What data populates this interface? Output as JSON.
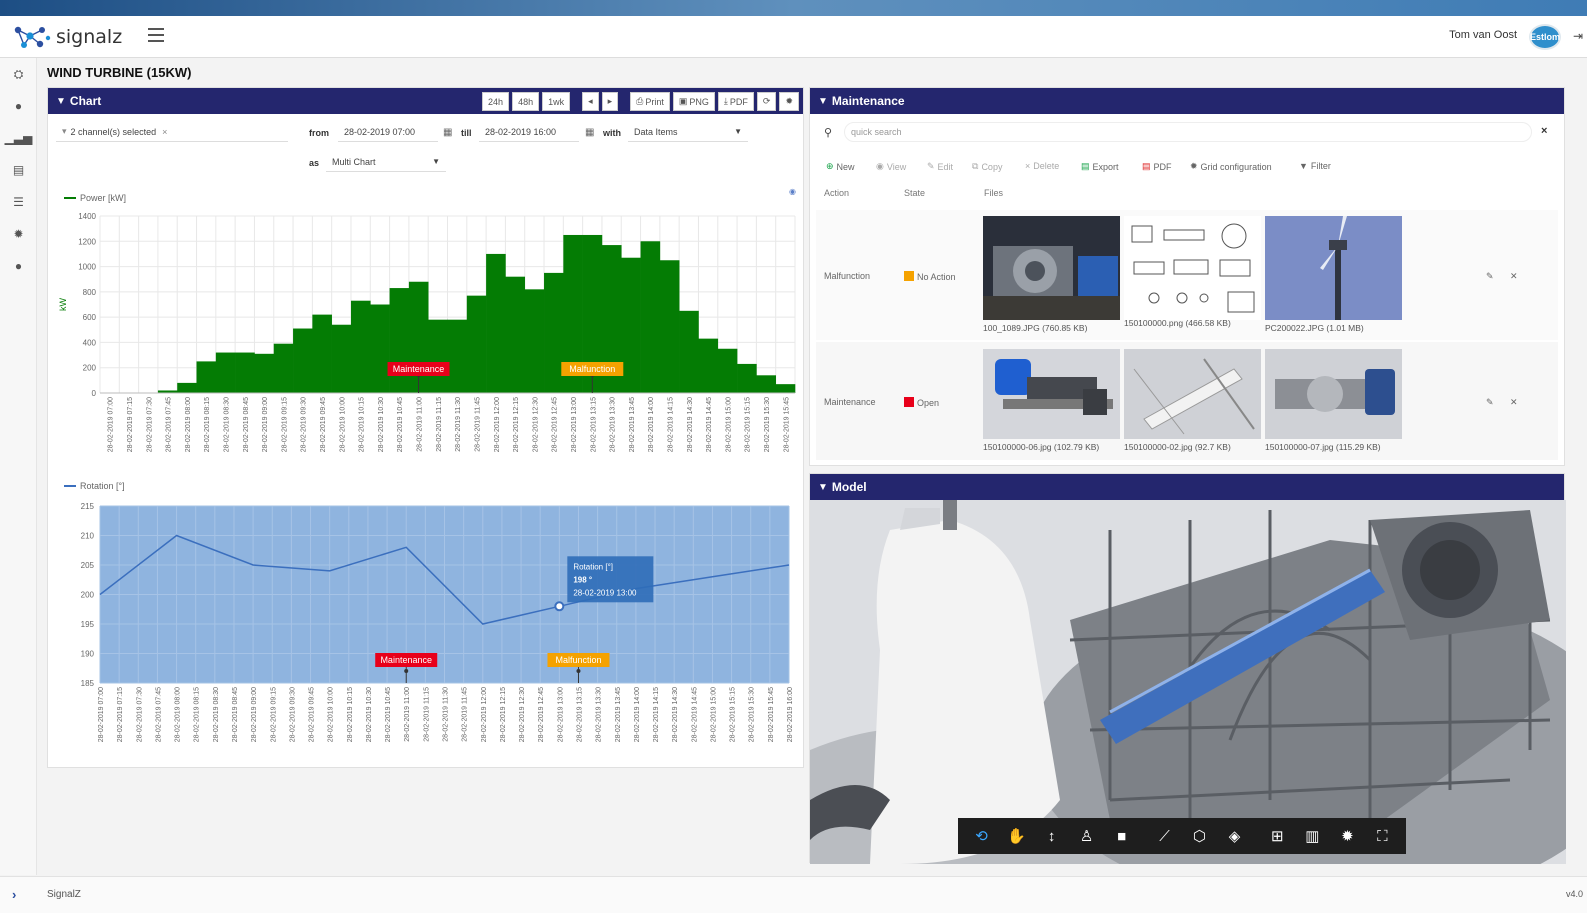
{
  "app": {
    "name": "signalz",
    "user": "Tom van Oost",
    "avatar_text": "Estlom",
    "footer_text": "SignalZ",
    "version": "v4.0"
  },
  "page": {
    "title": "WIND TURBINE (15KW)"
  },
  "colors": {
    "nav": "#24266e",
    "bar": "#047c04",
    "line_fill": "#8fb4df",
    "line": "#3b6fbe",
    "maintenance": "#e8001a",
    "malfunction": "#f5a200"
  },
  "sidebar": {
    "icons": [
      "dashboard-icon",
      "comment-icon",
      "bar-chart-icon",
      "report-icon",
      "sliders-icon",
      "gear-icon",
      "user-icon"
    ]
  },
  "chart_panel": {
    "title": "Chart",
    "range_buttons": [
      "24h",
      "48h",
      "1wk"
    ],
    "prev": "◂",
    "next": "▸",
    "print": "Print",
    "png": "PNG",
    "pdf": "PDF",
    "channels": "2 channel(s) selected",
    "from_label": "from",
    "from_value": "28-02-2019 07:00",
    "till_label": "till",
    "till_value": "28-02-2019 16:00",
    "with_label": "with",
    "with_value": "Data Items",
    "as_label": "as",
    "as_value": "Multi Chart"
  },
  "chart_data": [
    {
      "type": "bar",
      "legend": "Power [kW]",
      "ylabel": "kW",
      "ylim": [
        0,
        1400
      ],
      "yticks": [
        0,
        200,
        400,
        600,
        800,
        1000,
        1200,
        1400
      ],
      "categories": [
        "28-02-2019 07:00",
        "28-02-2019 07:15",
        "28-02-2019 07:30",
        "28-02-2019 07:45",
        "28-02-2019 08:00",
        "28-02-2019 08:15",
        "28-02-2019 08:30",
        "28-02-2019 08:45",
        "28-02-2019 09:00",
        "28-02-2019 09:15",
        "28-02-2019 09:30",
        "28-02-2019 09:45",
        "28-02-2019 10:00",
        "28-02-2019 10:15",
        "28-02-2019 10:30",
        "28-02-2019 10:45",
        "28-02-2019 11:00",
        "28-02-2019 11:15",
        "28-02-2019 11:30",
        "28-02-2019 11:45",
        "28-02-2019 12:00",
        "28-02-2019 12:15",
        "28-02-2019 12:30",
        "28-02-2019 12:45",
        "28-02-2019 13:00",
        "28-02-2019 13:15",
        "28-02-2019 13:30",
        "28-02-2019 13:45",
        "28-02-2019 14:00",
        "28-02-2019 14:15",
        "28-02-2019 14:30",
        "28-02-2019 14:45",
        "28-02-2019 15:00",
        "28-02-2019 15:15",
        "28-02-2019 15:30",
        "28-02-2019 15:45"
      ],
      "values": [
        0,
        0,
        0,
        20,
        80,
        250,
        320,
        320,
        310,
        390,
        510,
        620,
        540,
        730,
        700,
        830,
        880,
        580,
        580,
        770,
        1100,
        920,
        820,
        950,
        1250,
        1250,
        1170,
        1070,
        1200,
        1050,
        650,
        430,
        350,
        230,
        140,
        70
      ],
      "annotations": [
        {
          "label": "Maintenance",
          "x": "28-02-2019 11:00"
        },
        {
          "label": "Malfunction",
          "x": "28-02-2019 13:15"
        }
      ]
    },
    {
      "type": "line",
      "legend": "Rotation [°]",
      "ylim": [
        185,
        215
      ],
      "yticks": [
        185,
        190,
        195,
        200,
        205,
        210,
        215
      ],
      "x": [
        "28-02-2019 07:00",
        "28-02-2019 07:15",
        "28-02-2019 07:30",
        "28-02-2019 07:45",
        "28-02-2019 08:00",
        "28-02-2019 08:15",
        "28-02-2019 08:30",
        "28-02-2019 08:45",
        "28-02-2019 09:00",
        "28-02-2019 09:15",
        "28-02-2019 09:30",
        "28-02-2019 09:45",
        "28-02-2019 10:00",
        "28-02-2019 10:15",
        "28-02-2019 10:30",
        "28-02-2019 10:45",
        "28-02-2019 11:00",
        "28-02-2019 11:15",
        "28-02-2019 11:30",
        "28-02-2019 11:45",
        "28-02-2019 12:00",
        "28-02-2019 12:15",
        "28-02-2019 12:30",
        "28-02-2019 12:45",
        "28-02-2019 13:00",
        "28-02-2019 13:15",
        "28-02-2019 13:30",
        "28-02-2019 13:45",
        "28-02-2019 14:00",
        "28-02-2019 14:15",
        "28-02-2019 14:30",
        "28-02-2019 14:45",
        "28-02-2019 15:00",
        "28-02-2019 15:15",
        "28-02-2019 15:30",
        "28-02-2019 15:45",
        "28-02-2019 16:00"
      ],
      "points": [
        [
          "28-02-2019 07:00",
          200
        ],
        [
          "28-02-2019 08:00",
          210
        ],
        [
          "28-02-2019 09:00",
          205
        ],
        [
          "28-02-2019 10:00",
          204
        ],
        [
          "28-02-2019 11:00",
          208
        ],
        [
          "28-02-2019 12:00",
          195
        ],
        [
          "28-02-2019 13:00",
          198
        ],
        [
          "28-02-2019 14:00",
          201
        ],
        [
          "28-02-2019 15:00",
          203
        ],
        [
          "28-02-2019 16:00",
          205
        ]
      ],
      "tooltip": {
        "title": "Rotation [°]",
        "value": "198 °",
        "time": "28-02-2019 13:00"
      },
      "annotations": [
        {
          "label": "Maintenance",
          "x": "28-02-2019 11:00"
        },
        {
          "label": "Malfunction",
          "x": "28-02-2019 13:15"
        }
      ]
    }
  ],
  "maintenance": {
    "title": "Maintenance",
    "search_placeholder": "quick search",
    "toolbar": [
      "New",
      "View",
      "Edit",
      "Copy",
      "Delete",
      "Export",
      "PDF",
      "Grid configuration",
      "Filter"
    ],
    "columns": [
      "Action",
      "State",
      "Files"
    ],
    "rows": [
      {
        "action": "Malfunction",
        "state": "No Action",
        "state_color": "#f5a200",
        "files": [
          "100_1089.JPG (760.85 KB)",
          "150100000.png (466.58 KB)",
          "PC200022.JPG (1.01 MB)"
        ]
      },
      {
        "action": "Maintenance",
        "state": "Open",
        "state_color": "#e8001a",
        "files": [
          "150100000-06.jpg (102.79 KB)",
          "150100000-02.jpg (92.7 KB)",
          "150100000-07.jpg (115.29 KB)"
        ]
      }
    ]
  },
  "model": {
    "title": "Model",
    "tools": [
      "orbit-icon",
      "pan-icon",
      "zoom-icon",
      "first-person-icon",
      "camera-icon",
      "measure-icon",
      "explode-icon",
      "section-icon",
      "structure-icon",
      "properties-icon",
      "settings-icon",
      "fullscreen-icon"
    ]
  }
}
